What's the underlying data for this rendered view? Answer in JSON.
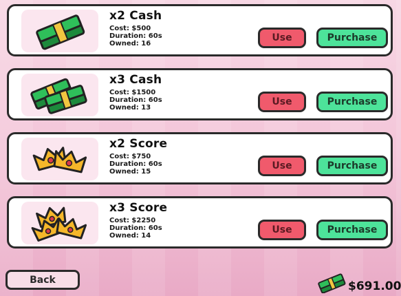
{
  "items": [
    {
      "title": "x2 Cash",
      "cost": "Cost: $500",
      "duration": "Duration: 60s",
      "owned": "Owned: 16",
      "icon": "cash-stack-icon",
      "use_label": "Use",
      "purchase_label": "Purchase"
    },
    {
      "title": "x3 Cash",
      "cost": "Cost: $1500",
      "duration": "Duration: 60s",
      "owned": "Owned: 13",
      "icon": "cash-stacks-icon",
      "use_label": "Use",
      "purchase_label": "Purchase"
    },
    {
      "title": "x2 Score",
      "cost": "Cost: $750",
      "duration": "Duration: 60s",
      "owned": "Owned: 15",
      "icon": "two-crowns-icon",
      "use_label": "Use",
      "purchase_label": "Purchase"
    },
    {
      "title": "x3 Score",
      "cost": "Cost: $2250",
      "duration": "Duration: 60s",
      "owned": "Owned: 14",
      "icon": "three-crowns-icon",
      "use_label": "Use",
      "purchase_label": "Purchase"
    }
  ],
  "footer": {
    "back_label": "Back",
    "balance": "$691.00",
    "balance_icon": "cash-stack-icon"
  },
  "colors": {
    "use": "#f05a6c",
    "purchase": "#4de39a",
    "card_border": "#2a2a2a",
    "thumb_bg": "#fbe6ef"
  }
}
